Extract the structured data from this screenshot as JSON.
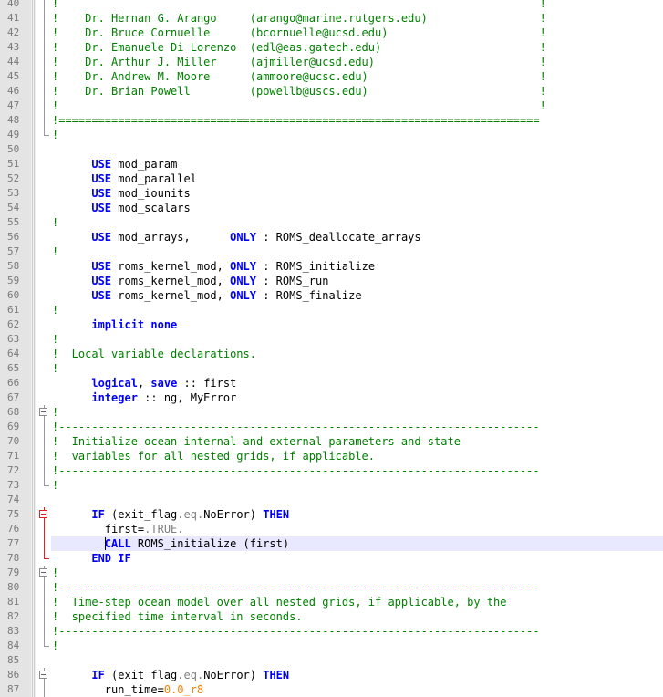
{
  "editor": {
    "lines": [
      {
        "n": "40",
        "fold": "line",
        "segs": [
          {
            "t": "!                                                                         !",
            "c": "cm"
          }
        ]
      },
      {
        "n": "41",
        "fold": "line",
        "segs": [
          {
            "t": "!    Dr. Hernan G. Arango     (arango@marine.rutgers.edu)                 !",
            "c": "cm"
          }
        ]
      },
      {
        "n": "42",
        "fold": "line",
        "segs": [
          {
            "t": "!    Dr. Bruce Cornuelle      (bcornuelle@ucsd.edu)                       !",
            "c": "cm"
          }
        ]
      },
      {
        "n": "43",
        "fold": "line",
        "segs": [
          {
            "t": "!    Dr. Emanuele Di Lorenzo  (edl@eas.gatech.edu)                        !",
            "c": "cm"
          }
        ]
      },
      {
        "n": "44",
        "fold": "line",
        "segs": [
          {
            "t": "!    Dr. Arthur J. Miller     (ajmiller@ucsd.edu)                         !",
            "c": "cm"
          }
        ]
      },
      {
        "n": "45",
        "fold": "line",
        "segs": [
          {
            "t": "!    Dr. Andrew M. Moore      (ammoore@ucsc.edu)                          !",
            "c": "cm"
          }
        ]
      },
      {
        "n": "46",
        "fold": "line",
        "segs": [
          {
            "t": "!    Dr. Brian Powell         (powellb@uscs.edu)                          !",
            "c": "cm"
          }
        ]
      },
      {
        "n": "47",
        "fold": "line",
        "segs": [
          {
            "t": "!                                                                         !",
            "c": "cm"
          }
        ]
      },
      {
        "n": "48",
        "fold": "line",
        "segs": [
          {
            "t": "!=========================================================================",
            "c": "cm"
          }
        ]
      },
      {
        "n": "49",
        "fold": "end",
        "segs": [
          {
            "t": "!",
            "c": "cm"
          }
        ]
      },
      {
        "n": "50",
        "fold": "none",
        "segs": []
      },
      {
        "n": "51",
        "fold": "none",
        "segs": [
          {
            "t": "      "
          },
          {
            "t": "USE",
            "c": "kw"
          },
          {
            "t": " mod_param"
          }
        ]
      },
      {
        "n": "52",
        "fold": "none",
        "segs": [
          {
            "t": "      "
          },
          {
            "t": "USE",
            "c": "kw"
          },
          {
            "t": " mod_parallel"
          }
        ]
      },
      {
        "n": "53",
        "fold": "none",
        "segs": [
          {
            "t": "      "
          },
          {
            "t": "USE",
            "c": "kw"
          },
          {
            "t": " mod_iounits"
          }
        ]
      },
      {
        "n": "54",
        "fold": "none",
        "segs": [
          {
            "t": "      "
          },
          {
            "t": "USE",
            "c": "kw"
          },
          {
            "t": " mod_scalars"
          }
        ]
      },
      {
        "n": "55",
        "fold": "none",
        "segs": [
          {
            "t": "!",
            "c": "cm"
          }
        ]
      },
      {
        "n": "56",
        "fold": "none",
        "segs": [
          {
            "t": "      "
          },
          {
            "t": "USE",
            "c": "kw"
          },
          {
            "t": " mod_arrays,      "
          },
          {
            "t": "ONLY",
            "c": "kw"
          },
          {
            "t": " : ROMS_deallocate_arrays"
          }
        ]
      },
      {
        "n": "57",
        "fold": "none",
        "segs": [
          {
            "t": "!",
            "c": "cm"
          }
        ]
      },
      {
        "n": "58",
        "fold": "none",
        "segs": [
          {
            "t": "      "
          },
          {
            "t": "USE",
            "c": "kw"
          },
          {
            "t": " roms_kernel_mod, "
          },
          {
            "t": "ONLY",
            "c": "kw"
          },
          {
            "t": " : ROMS_initialize"
          }
        ]
      },
      {
        "n": "59",
        "fold": "none",
        "segs": [
          {
            "t": "      "
          },
          {
            "t": "USE",
            "c": "kw"
          },
          {
            "t": " roms_kernel_mod, "
          },
          {
            "t": "ONLY",
            "c": "kw"
          },
          {
            "t": " : ROMS_run"
          }
        ]
      },
      {
        "n": "60",
        "fold": "none",
        "segs": [
          {
            "t": "      "
          },
          {
            "t": "USE",
            "c": "kw"
          },
          {
            "t": " roms_kernel_mod, "
          },
          {
            "t": "ONLY",
            "c": "kw"
          },
          {
            "t": " : ROMS_finalize"
          }
        ]
      },
      {
        "n": "61",
        "fold": "none",
        "segs": [
          {
            "t": "!",
            "c": "cm"
          }
        ]
      },
      {
        "n": "62",
        "fold": "none",
        "segs": [
          {
            "t": "      "
          },
          {
            "t": "implicit none",
            "c": "kw"
          }
        ]
      },
      {
        "n": "63",
        "fold": "none",
        "segs": [
          {
            "t": "!",
            "c": "cm"
          }
        ]
      },
      {
        "n": "64",
        "fold": "none",
        "segs": [
          {
            "t": "!  Local variable declarations.",
            "c": "cm"
          }
        ]
      },
      {
        "n": "65",
        "fold": "none",
        "segs": [
          {
            "t": "!",
            "c": "cm"
          }
        ]
      },
      {
        "n": "66",
        "fold": "none",
        "segs": [
          {
            "t": "      "
          },
          {
            "t": "logical",
            "c": "kw"
          },
          {
            "t": ", "
          },
          {
            "t": "save",
            "c": "kw"
          },
          {
            "t": " :: first"
          }
        ]
      },
      {
        "n": "67",
        "fold": "none",
        "segs": [
          {
            "t": "      "
          },
          {
            "t": "integer",
            "c": "kw"
          },
          {
            "t": " :: ng, MyError"
          }
        ]
      },
      {
        "n": "68",
        "fold": "box",
        "segs": [
          {
            "t": "!",
            "c": "cm"
          }
        ]
      },
      {
        "n": "69",
        "fold": "line",
        "segs": [
          {
            "t": "!-------------------------------------------------------------------------",
            "c": "cm"
          }
        ]
      },
      {
        "n": "70",
        "fold": "line",
        "segs": [
          {
            "t": "!  Initialize ocean internal and external parameters and state",
            "c": "cm"
          }
        ]
      },
      {
        "n": "71",
        "fold": "line",
        "segs": [
          {
            "t": "!  variables for all nested grids, if applicable.",
            "c": "cm"
          }
        ]
      },
      {
        "n": "72",
        "fold": "line",
        "segs": [
          {
            "t": "!-------------------------------------------------------------------------",
            "c": "cm"
          }
        ]
      },
      {
        "n": "73",
        "fold": "end",
        "segs": [
          {
            "t": "!",
            "c": "cm"
          }
        ]
      },
      {
        "n": "74",
        "fold": "none",
        "segs": []
      },
      {
        "n": "75",
        "fold": "redbox",
        "segs": [
          {
            "t": "      "
          },
          {
            "t": "IF",
            "c": "kw"
          },
          {
            "t": " (exit_flag"
          },
          {
            "t": ".eq.",
            "c": "cst"
          },
          {
            "t": "NoError) "
          },
          {
            "t": "THEN",
            "c": "kw"
          }
        ]
      },
      {
        "n": "76",
        "fold": "redline",
        "segs": [
          {
            "t": "        first="
          },
          {
            "t": ".TRUE.",
            "c": "cst"
          }
        ]
      },
      {
        "n": "77",
        "fold": "redline",
        "current": true,
        "segs": [
          {
            "t": "        "
          },
          {
            "t": "CALL",
            "c": "kw"
          },
          {
            "t": " ROMS_initialize (first)"
          }
        ]
      },
      {
        "n": "78",
        "fold": "redend",
        "segs": [
          {
            "t": "      "
          },
          {
            "t": "END IF",
            "c": "kw"
          }
        ]
      },
      {
        "n": "79",
        "fold": "box",
        "segs": [
          {
            "t": "!",
            "c": "cm"
          }
        ]
      },
      {
        "n": "80",
        "fold": "line",
        "segs": [
          {
            "t": "!-------------------------------------------------------------------------",
            "c": "cm"
          }
        ]
      },
      {
        "n": "81",
        "fold": "line",
        "segs": [
          {
            "t": "!  Time-step ocean model over all nested grids, if applicable, by the",
            "c": "cm"
          }
        ]
      },
      {
        "n": "82",
        "fold": "line",
        "segs": [
          {
            "t": "!  specified time interval in seconds.",
            "c": "cm"
          }
        ]
      },
      {
        "n": "83",
        "fold": "line",
        "segs": [
          {
            "t": "!-------------------------------------------------------------------------",
            "c": "cm"
          }
        ]
      },
      {
        "n": "84",
        "fold": "end",
        "segs": [
          {
            "t": "!",
            "c": "cm"
          }
        ]
      },
      {
        "n": "85",
        "fold": "none",
        "segs": []
      },
      {
        "n": "86",
        "fold": "box",
        "segs": [
          {
            "t": "      "
          },
          {
            "t": "IF",
            "c": "kw"
          },
          {
            "t": " (exit_flag"
          },
          {
            "t": ".eq.",
            "c": "cst"
          },
          {
            "t": "NoError) "
          },
          {
            "t": "THEN",
            "c": "kw"
          }
        ]
      },
      {
        "n": "87",
        "fold": "line",
        "segs": [
          {
            "t": "        run_time="
          },
          {
            "t": "0.0_r8",
            "c": "num"
          }
        ]
      }
    ]
  }
}
